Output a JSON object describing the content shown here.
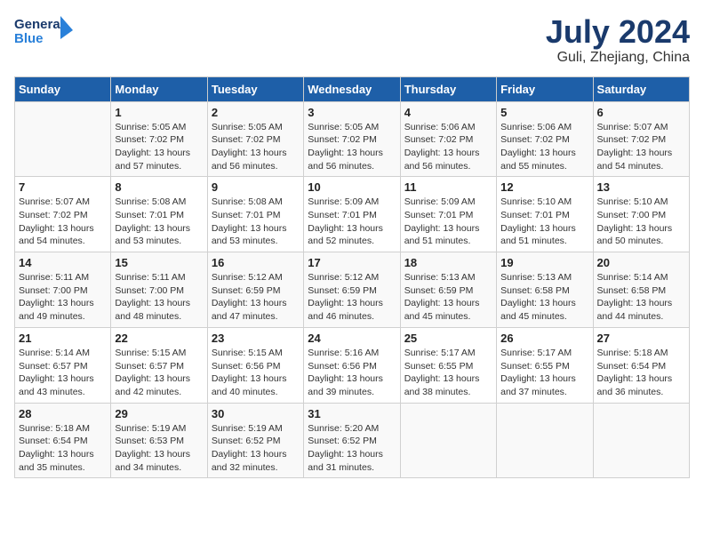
{
  "header": {
    "logo_line1": "General",
    "logo_line2": "Blue",
    "title": "July 2024",
    "subtitle": "Guli, Zhejiang, China"
  },
  "days_of_week": [
    "Sunday",
    "Monday",
    "Tuesday",
    "Wednesday",
    "Thursday",
    "Friday",
    "Saturday"
  ],
  "weeks": [
    [
      {
        "day": "",
        "info": ""
      },
      {
        "day": "1",
        "info": "Sunrise: 5:05 AM\nSunset: 7:02 PM\nDaylight: 13 hours\nand 57 minutes."
      },
      {
        "day": "2",
        "info": "Sunrise: 5:05 AM\nSunset: 7:02 PM\nDaylight: 13 hours\nand 56 minutes."
      },
      {
        "day": "3",
        "info": "Sunrise: 5:05 AM\nSunset: 7:02 PM\nDaylight: 13 hours\nand 56 minutes."
      },
      {
        "day": "4",
        "info": "Sunrise: 5:06 AM\nSunset: 7:02 PM\nDaylight: 13 hours\nand 56 minutes."
      },
      {
        "day": "5",
        "info": "Sunrise: 5:06 AM\nSunset: 7:02 PM\nDaylight: 13 hours\nand 55 minutes."
      },
      {
        "day": "6",
        "info": "Sunrise: 5:07 AM\nSunset: 7:02 PM\nDaylight: 13 hours\nand 54 minutes."
      }
    ],
    [
      {
        "day": "7",
        "info": "Sunrise: 5:07 AM\nSunset: 7:02 PM\nDaylight: 13 hours\nand 54 minutes."
      },
      {
        "day": "8",
        "info": "Sunrise: 5:08 AM\nSunset: 7:01 PM\nDaylight: 13 hours\nand 53 minutes."
      },
      {
        "day": "9",
        "info": "Sunrise: 5:08 AM\nSunset: 7:01 PM\nDaylight: 13 hours\nand 53 minutes."
      },
      {
        "day": "10",
        "info": "Sunrise: 5:09 AM\nSunset: 7:01 PM\nDaylight: 13 hours\nand 52 minutes."
      },
      {
        "day": "11",
        "info": "Sunrise: 5:09 AM\nSunset: 7:01 PM\nDaylight: 13 hours\nand 51 minutes."
      },
      {
        "day": "12",
        "info": "Sunrise: 5:10 AM\nSunset: 7:01 PM\nDaylight: 13 hours\nand 51 minutes."
      },
      {
        "day": "13",
        "info": "Sunrise: 5:10 AM\nSunset: 7:00 PM\nDaylight: 13 hours\nand 50 minutes."
      }
    ],
    [
      {
        "day": "14",
        "info": "Sunrise: 5:11 AM\nSunset: 7:00 PM\nDaylight: 13 hours\nand 49 minutes."
      },
      {
        "day": "15",
        "info": "Sunrise: 5:11 AM\nSunset: 7:00 PM\nDaylight: 13 hours\nand 48 minutes."
      },
      {
        "day": "16",
        "info": "Sunrise: 5:12 AM\nSunset: 6:59 PM\nDaylight: 13 hours\nand 47 minutes."
      },
      {
        "day": "17",
        "info": "Sunrise: 5:12 AM\nSunset: 6:59 PM\nDaylight: 13 hours\nand 46 minutes."
      },
      {
        "day": "18",
        "info": "Sunrise: 5:13 AM\nSunset: 6:59 PM\nDaylight: 13 hours\nand 45 minutes."
      },
      {
        "day": "19",
        "info": "Sunrise: 5:13 AM\nSunset: 6:58 PM\nDaylight: 13 hours\nand 45 minutes."
      },
      {
        "day": "20",
        "info": "Sunrise: 5:14 AM\nSunset: 6:58 PM\nDaylight: 13 hours\nand 44 minutes."
      }
    ],
    [
      {
        "day": "21",
        "info": "Sunrise: 5:14 AM\nSunset: 6:57 PM\nDaylight: 13 hours\nand 43 minutes."
      },
      {
        "day": "22",
        "info": "Sunrise: 5:15 AM\nSunset: 6:57 PM\nDaylight: 13 hours\nand 42 minutes."
      },
      {
        "day": "23",
        "info": "Sunrise: 5:15 AM\nSunset: 6:56 PM\nDaylight: 13 hours\nand 40 minutes."
      },
      {
        "day": "24",
        "info": "Sunrise: 5:16 AM\nSunset: 6:56 PM\nDaylight: 13 hours\nand 39 minutes."
      },
      {
        "day": "25",
        "info": "Sunrise: 5:17 AM\nSunset: 6:55 PM\nDaylight: 13 hours\nand 38 minutes."
      },
      {
        "day": "26",
        "info": "Sunrise: 5:17 AM\nSunset: 6:55 PM\nDaylight: 13 hours\nand 37 minutes."
      },
      {
        "day": "27",
        "info": "Sunrise: 5:18 AM\nSunset: 6:54 PM\nDaylight: 13 hours\nand 36 minutes."
      }
    ],
    [
      {
        "day": "28",
        "info": "Sunrise: 5:18 AM\nSunset: 6:54 PM\nDaylight: 13 hours\nand 35 minutes."
      },
      {
        "day": "29",
        "info": "Sunrise: 5:19 AM\nSunset: 6:53 PM\nDaylight: 13 hours\nand 34 minutes."
      },
      {
        "day": "30",
        "info": "Sunrise: 5:19 AM\nSunset: 6:52 PM\nDaylight: 13 hours\nand 32 minutes."
      },
      {
        "day": "31",
        "info": "Sunrise: 5:20 AM\nSunset: 6:52 PM\nDaylight: 13 hours\nand 31 minutes."
      },
      {
        "day": "",
        "info": ""
      },
      {
        "day": "",
        "info": ""
      },
      {
        "day": "",
        "info": ""
      }
    ]
  ]
}
